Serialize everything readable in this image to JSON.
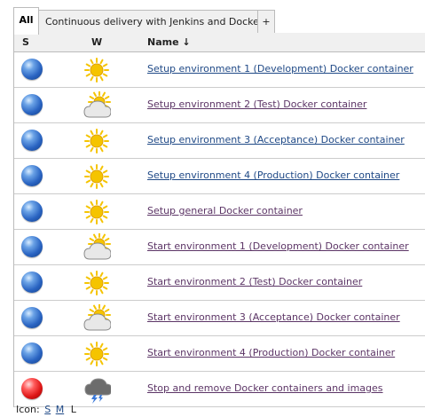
{
  "tabs": [
    {
      "label": "All",
      "active": true
    },
    {
      "label": "Continuous delivery with Jenkins and Docker",
      "active": false
    },
    {
      "label": "+",
      "active": false
    }
  ],
  "columns": {
    "status": "S",
    "weather": "W",
    "name": "Name  ↓"
  },
  "jobs": [
    {
      "name": "Setup environment 1 (Development) Docker container",
      "status": "blue",
      "weather": "sunny"
    },
    {
      "name": "Setup environment 2 (Test) Docker container",
      "status": "blue",
      "weather": "partly-cloudy"
    },
    {
      "name": "Setup environment 3 (Acceptance) Docker container",
      "status": "blue",
      "weather": "sunny"
    },
    {
      "name": "Setup environment 4 (Production) Docker container",
      "status": "blue",
      "weather": "sunny"
    },
    {
      "name": "Setup general Docker container",
      "status": "blue",
      "weather": "sunny"
    },
    {
      "name": "Start environment 1 (Development) Docker container",
      "status": "blue",
      "weather": "partly-cloudy"
    },
    {
      "name": "Start environment 2 (Test) Docker container",
      "status": "blue",
      "weather": "sunny"
    },
    {
      "name": "Start environment 3 (Acceptance) Docker container",
      "status": "blue",
      "weather": "partly-cloudy"
    },
    {
      "name": "Start environment 4 (Production) Docker container",
      "status": "blue",
      "weather": "sunny"
    },
    {
      "name": "Stop and remove Docker containers and images",
      "status": "red",
      "weather": "thunderstorm"
    }
  ],
  "footer": {
    "label": "Icon:",
    "sizes": [
      "S",
      "M",
      "L"
    ],
    "current_size": "L"
  },
  "colors": {
    "success": "#2a64c2",
    "failure": "#dd1515",
    "sun": "#f5c400",
    "link": "#204a87"
  }
}
